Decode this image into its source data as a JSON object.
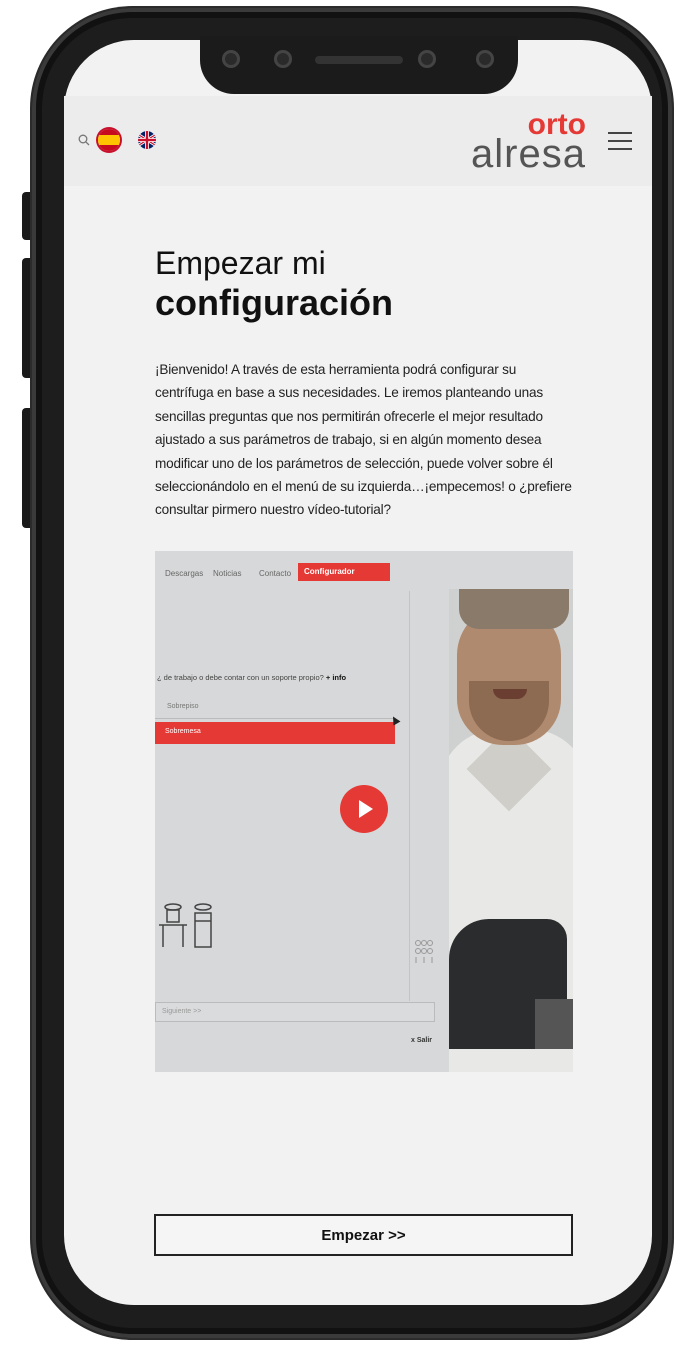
{
  "header": {
    "logo_top": "orto",
    "logo_bottom": "alresa",
    "icons": [
      "search-icon",
      "flag-es-icon",
      "flag-uk-icon",
      "menu-icon"
    ]
  },
  "main": {
    "title_line1": "Empezar mi",
    "title_line2": "configuración",
    "intro": "¡Bienvenido! A través de esta herramienta podrá configurar su centrífuga en base a sus necesidades. Le iremos planteando unas sencillas preguntas que nos permitirán ofrecerle el mejor resultado ajustado a sus parámetros de trabajo, si en algún momento desea modificar uno de los parámetros de selección, puede volver sobre él seleccionándolo en el menú de su izquierda…¡empecemos! o ¿prefiere consultar pirmero nuestro vídeo-tutorial?"
  },
  "video": {
    "nav": [
      "Descargas",
      "Noticias",
      "Contacto"
    ],
    "nav_active": "Configurador",
    "question": "¿ de trabajo o debe contar con un soporte propio?",
    "question_link": "+ info",
    "option_1": "Sobrepiso",
    "option_2": "Sobremesa",
    "input_placeholder": "Siguiente >>",
    "exit": "x Salir"
  },
  "cta": {
    "label": "Empezar >>"
  },
  "colors": {
    "accent": "#e53935",
    "background": "#f2f2f2",
    "text": "#111111"
  }
}
